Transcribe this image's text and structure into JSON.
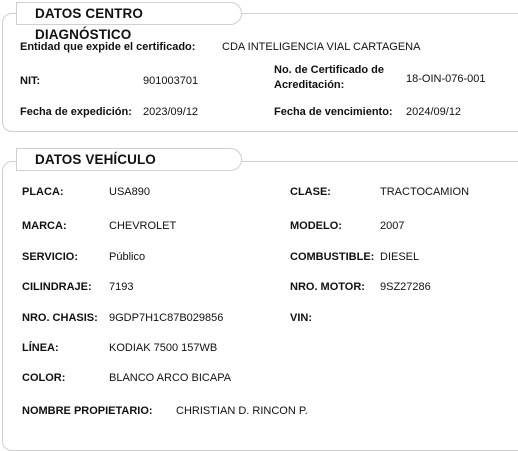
{
  "centro": {
    "title": "DATOS CENTRO DIAGNÓSTICO",
    "entidad_label": "Entidad que expide el certificado:",
    "entidad_value": "CDA INTELIGENCIA VIAL CARTAGENA",
    "nit_label": "NIT:",
    "nit_value": "901003701",
    "cert_label_line1": "No. de Certificado de",
    "cert_label_line2": "Acreditación:",
    "cert_value": "18-OIN-076-001",
    "expedicion_label": "Fecha de expedición:",
    "expedicion_value": "2023/09/12",
    "vencimiento_label": "Fecha de vencimiento:",
    "vencimiento_value": "2024/09/12"
  },
  "vehiculo": {
    "title": "DATOS VEHÍCULO",
    "placa_label": "PLACA:",
    "placa_value": "USA890",
    "clase_label": "CLASE:",
    "clase_value": "TRACTOCAMION",
    "marca_label": "MARCA:",
    "marca_value": "CHEVROLET",
    "modelo_label": "MODELO:",
    "modelo_value": "2007",
    "servicio_label": "SERVICIO:",
    "servicio_value": "Público",
    "combustible_label": "COMBUSTIBLE:",
    "combustible_value": "DIESEL",
    "cilindraje_label": "CILINDRAJE:",
    "cilindraje_value": "7193",
    "motor_label": "NRO. MOTOR:",
    "motor_value": "9SZ27286",
    "chasis_label": "NRO. CHASIS:",
    "chasis_value": "9GDP7H1C87B029856",
    "vin_label": "VIN:",
    "vin_value": "",
    "linea_label": "LÍNEA:",
    "linea_value": "KODIAK 7500 157WB",
    "color_label": "COLOR:",
    "color_value": "BLANCO ARCO BICAPA",
    "propietario_label": "NOMBRE PROPIETARIO:",
    "propietario_value": "CHRISTIAN D. RINCON P."
  }
}
